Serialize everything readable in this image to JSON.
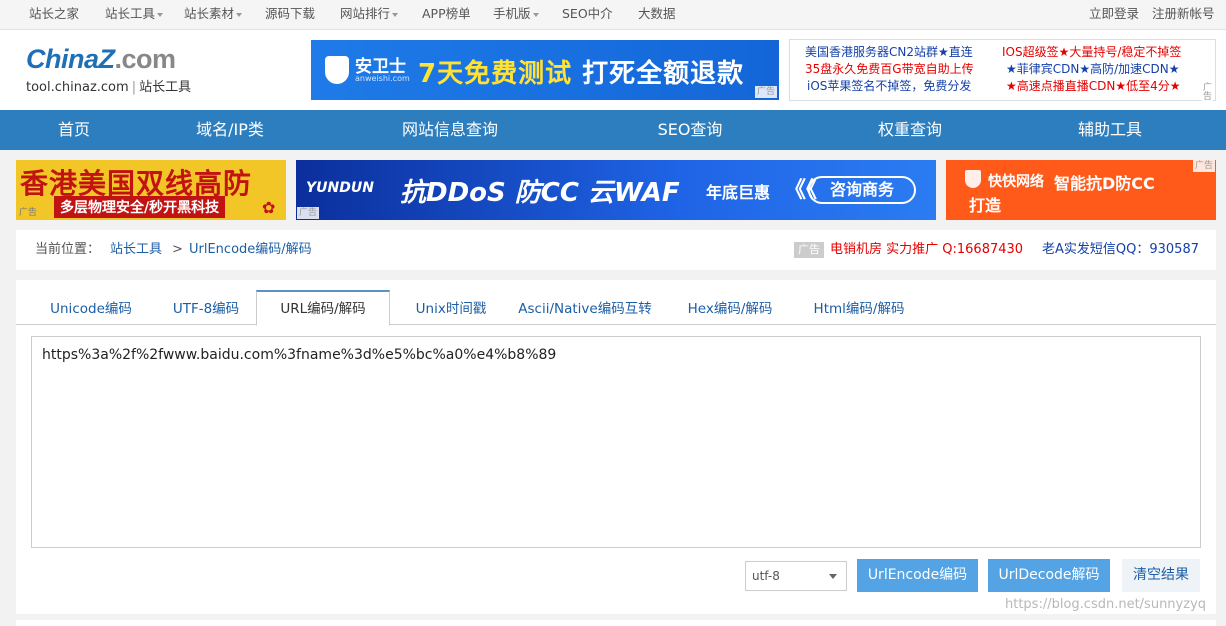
{
  "top_nav": {
    "left": [
      {
        "label": "站长之家",
        "dropdown": false
      },
      {
        "label": "站长工具",
        "dropdown": true
      },
      {
        "label": "站长素材",
        "dropdown": true
      },
      {
        "label": "源码下载",
        "dropdown": false
      },
      {
        "label": "网站排行",
        "dropdown": true
      },
      {
        "label": "APP榜单",
        "dropdown": false
      },
      {
        "label": "手机版",
        "dropdown": true
      },
      {
        "label": "SEO中介",
        "dropdown": false
      },
      {
        "label": "大数据",
        "dropdown": false
      }
    ],
    "login": "立即登录",
    "register": "注册新帐号"
  },
  "logo": {
    "main": "ChinaZ",
    "com": ".com",
    "domain": "tool.chinaz.com",
    "sep": "|",
    "name": "站长工具"
  },
  "header_ad": {
    "brand": "安卫士",
    "brand_sub": "anweishi.com",
    "slogan_yellow": "7天免费测试",
    "slogan_white": "打死全额退款",
    "tag": "广告"
  },
  "text_ads": {
    "r1l": "美国香港服务器CN2站群★直连",
    "r1r": "IOS超级签★大量持号/稳定不掉签",
    "r2l": "35盘永久免费百G带宽自助上传",
    "r2r": "★菲律宾CDN★高防/加速CDN★",
    "r3l": "iOS苹果签名不掉签，免费分发",
    "r3r": "★高速点播直播CDN★低至4分★",
    "tag": "广告"
  },
  "main_nav": [
    "首页",
    "域名/IP类",
    "网站信息查询",
    "SEO查询",
    "权重查询",
    "辅助工具"
  ],
  "banners": {
    "b1_big": "香港美国双线高防",
    "b1_small": "多层物理安全/秒开黑科技",
    "b1_tag": "广告",
    "b2_brand": "YUNDUN",
    "b2_main": "抗DDoS 防CC 云WAF",
    "b2_deal": "年底巨惠",
    "b2_arrows": "《《",
    "b2_button": "咨询商务",
    "b2_tag": "广告",
    "b3_t1": "快快网络",
    "b3_t2": "智能抗D防CC",
    "b3_t3": "打造",
    "b3_tag": "广告"
  },
  "breadcrumb": {
    "prefix": "当前位置：",
    "root": "站长工具",
    "sep": ">",
    "current": "UrlEncode编码/解码",
    "ad_badge": "广告",
    "ad_red": "电销机房 实力推广 Q:16687430",
    "ad_blue": "老A实发短信QQ：930587"
  },
  "tabs": [
    "Unicode编码",
    "UTF-8编码",
    "URL编码/解码",
    "Unix时间戳",
    "Ascii/Native编码互转",
    "Hex编码/解码",
    "Html编码/解码"
  ],
  "active_tab": 2,
  "editor": {
    "value": "https%3a%2f%2fwww.baidu.com%3fname%3d%e5%bc%a0%e4%b8%89"
  },
  "controls": {
    "charset": "utf-8",
    "encode_btn": "UrlEncode编码",
    "decode_btn": "UrlDecode解码",
    "clear_btn": "清空结果"
  },
  "watermark": "https://blog.csdn.net/sunnyzyq"
}
